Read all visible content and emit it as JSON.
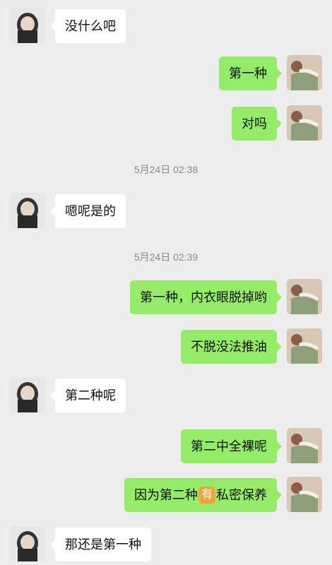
{
  "theme": {
    "background": "#ededed",
    "incoming_bubble": "#ffffff",
    "outgoing_bubble": "#95ec69",
    "timestamp_color": "#8a8a8a",
    "sticker_color": "#f0a43a"
  },
  "messages": [
    {
      "side": "left",
      "text": "没什么吧"
    },
    {
      "side": "right",
      "text": "第一种"
    },
    {
      "side": "right",
      "text": "对吗"
    },
    {
      "timestamp": "5月24日 02:38"
    },
    {
      "side": "left",
      "text": "嗯呢是的"
    },
    {
      "timestamp": "5月24日 02:39"
    },
    {
      "side": "right",
      "text": "第一种，内衣眼脱掉哟"
    },
    {
      "side": "right",
      "text": "不脱没法推油"
    },
    {
      "side": "left",
      "text": "第二种呢"
    },
    {
      "side": "right",
      "text": "第二中全裸呢"
    },
    {
      "side": "right",
      "before": "因为第二种",
      "emoji": "有",
      "after": "私密保养"
    },
    {
      "side": "left",
      "text": "那还是第一种"
    }
  ],
  "icons": {
    "left_avatar": "avatar-icon",
    "right_avatar": "photo-avatar-icon"
  }
}
